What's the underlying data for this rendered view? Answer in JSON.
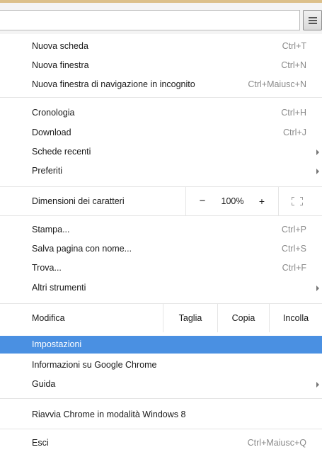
{
  "menu": {
    "section1": [
      {
        "label": "Nuova scheda",
        "shortcut": "Ctrl+T"
      },
      {
        "label": "Nuova finestra",
        "shortcut": "Ctrl+N"
      },
      {
        "label": "Nuova finestra di navigazione in incognito",
        "shortcut": "Ctrl+Maiusc+N"
      }
    ],
    "section2": [
      {
        "label": "Cronologia",
        "shortcut": "Ctrl+H"
      },
      {
        "label": "Download",
        "shortcut": "Ctrl+J"
      },
      {
        "label": "Schede recenti"
      },
      {
        "label": "Preferiti"
      }
    ],
    "zoom": {
      "label": "Dimensioni dei caratteri",
      "minus": "−",
      "value": "100%",
      "plus": "+"
    },
    "section3": [
      {
        "label": "Stampa...",
        "shortcut": "Ctrl+P"
      },
      {
        "label": "Salva pagina con nome...",
        "shortcut": "Ctrl+S"
      },
      {
        "label": "Trova...",
        "shortcut": "Ctrl+F"
      },
      {
        "label": "Altri strumenti"
      }
    ],
    "edit": {
      "label": "Modifica",
      "cut": "Taglia",
      "copy": "Copia",
      "paste": "Incolla"
    },
    "section4": [
      {
        "label": "Impostazioni"
      },
      {
        "label": "Informazioni su Google Chrome"
      },
      {
        "label": "Guida"
      }
    ],
    "section5": [
      {
        "label": "Riavvia Chrome in modalità Windows 8"
      }
    ],
    "section6": [
      {
        "label": "Esci",
        "shortcut": "Ctrl+Maiusc+Q"
      }
    ]
  },
  "colors": {
    "highlight": "#4a90e2",
    "shortcut": "#8a8a8a",
    "topbar_accent": "#dcc08a"
  },
  "icons": {
    "menu_button": "hamburger-icon",
    "fullscreen": "fullscreen-icon",
    "submenu": "chevron-right-icon"
  }
}
